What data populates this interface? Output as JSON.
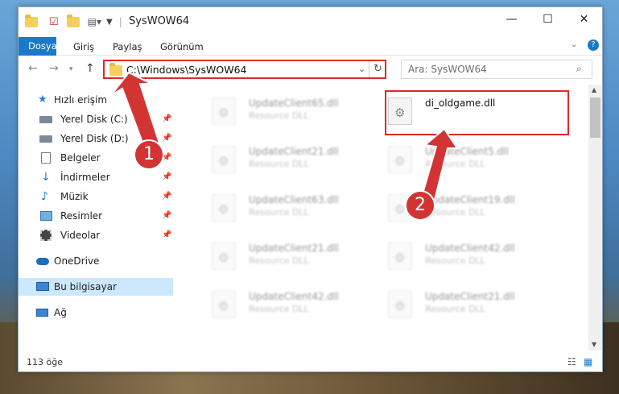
{
  "window": {
    "title": "SysWOW64"
  },
  "ribbon": {
    "tabs": [
      "Dosya",
      "Giriş",
      "Paylaş",
      "Görünüm"
    ]
  },
  "address": {
    "path": "C:\\Windows\\SysWOW64"
  },
  "search": {
    "placeholder": "Ara: SysWOW64"
  },
  "nav": {
    "items": [
      {
        "label": "Hızlı erişim",
        "icon": "star-icon"
      },
      {
        "label": "Yerel Disk (C:)",
        "icon": "drive-icon",
        "pinned": true
      },
      {
        "label": "Yerel Disk (D:)",
        "icon": "drive-icon",
        "pinned": true
      },
      {
        "label": "Belgeler",
        "icon": "documents-icon",
        "pinned": true
      },
      {
        "label": "İndirmeler",
        "icon": "download-icon",
        "pinned": true
      },
      {
        "label": "Müzik",
        "icon": "music-icon",
        "pinned": true
      },
      {
        "label": "Resimler",
        "icon": "pictures-icon",
        "pinned": true
      },
      {
        "label": "Videolar",
        "icon": "videos-icon",
        "pinned": true
      },
      {
        "label": "OneDrive",
        "icon": "cloud-icon"
      },
      {
        "label": "Bu bilgisayar",
        "icon": "computer-icon",
        "selected": true
      },
      {
        "label": "Ağ",
        "icon": "network-icon"
      }
    ]
  },
  "files": [
    {
      "name": "UpdateClient65.dll",
      "type": "Resource DLL"
    },
    {
      "name": "di_oldgame.dll",
      "type": ""
    },
    {
      "name": "UpdateClient21.dll",
      "type": "Resource DLL"
    },
    {
      "name": "UpdateClient5.dll",
      "type": "Resource DLL"
    },
    {
      "name": "UpdateClient63.dll",
      "type": "Resource DLL"
    },
    {
      "name": "UpdateClient19.dll",
      "type": "Resource DLL"
    },
    {
      "name": "UpdateClient21.dll",
      "type": "Resource DLL"
    },
    {
      "name": "UpdateClient42.dll",
      "type": "Resource DLL"
    },
    {
      "name": "UpdateClient42.dll",
      "type": "Resource DLL"
    },
    {
      "name": "UpdateClient21.dll",
      "type": "Resource DLL"
    }
  ],
  "status": {
    "count": "113 öğe"
  },
  "markers": [
    "1",
    "2"
  ],
  "colors": {
    "accent": "#1979ca",
    "highlight": "#e02828",
    "marker": "#d23434"
  }
}
